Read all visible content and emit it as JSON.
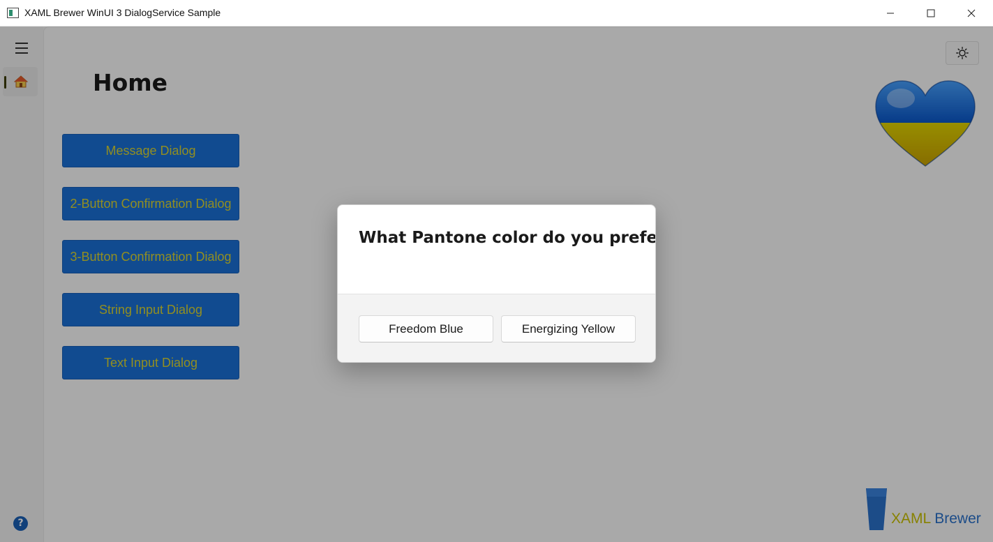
{
  "window": {
    "title": "XAML Brewer WinUI 3 DialogService Sample"
  },
  "nav": {
    "menu_icon": "hamburger-menu-icon",
    "home_icon": "house-icon",
    "help_icon": "question-mark-icon",
    "help_glyph": "?"
  },
  "page": {
    "title": "Home",
    "buttons": [
      "Message Dialog",
      "2-Button Confirmation Dialog",
      "3-Button Confirmation Dialog",
      "String Input Dialog",
      "Text Input Dialog"
    ],
    "theme_toggle_icon": "sun-icon",
    "heart_image": "ukraine-heart-icon"
  },
  "brand": {
    "part1": "XAML",
    "part2": " Brewer"
  },
  "dialog": {
    "title": "What Pantone color do you prefer?",
    "primary_label": "Freedom Blue",
    "secondary_label": "Energizing Yellow"
  },
  "colors": {
    "button_bg": "#1a6fd4",
    "button_text": "#d7d232",
    "brand_yellow": "#c8bf00",
    "brand_blue": "#2a70c9"
  }
}
